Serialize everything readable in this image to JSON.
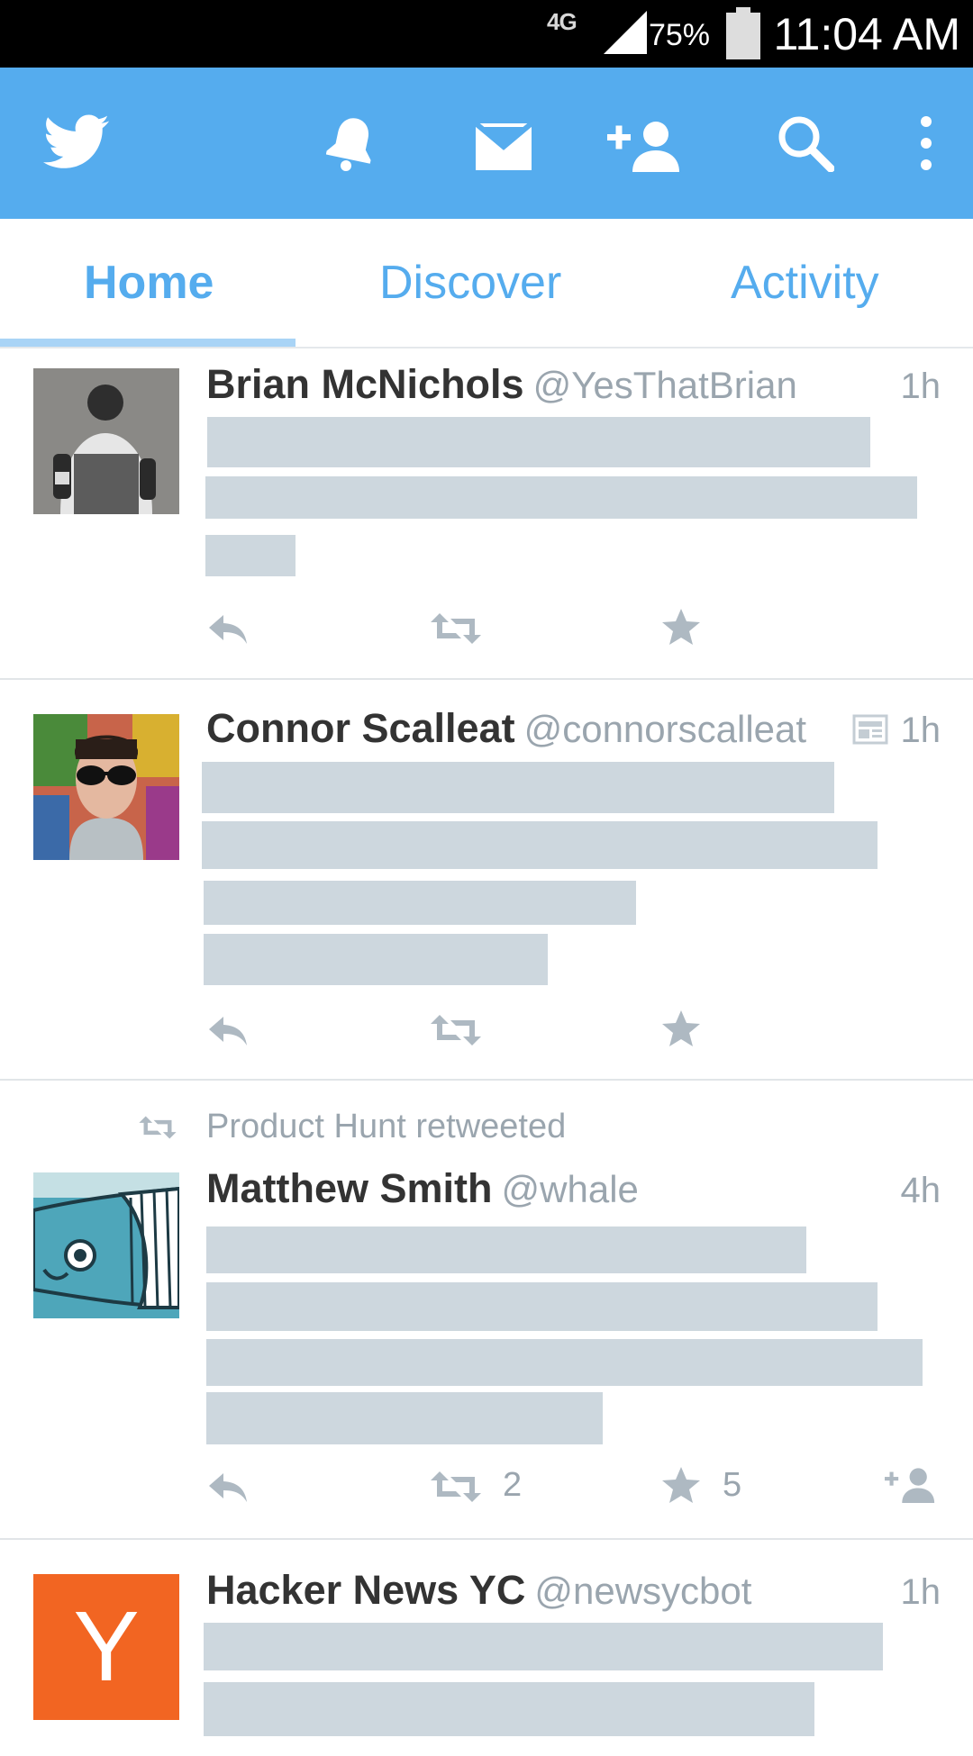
{
  "status_bar": {
    "network": "4G",
    "battery": "75%",
    "time": "11:04 AM"
  },
  "app_bar": {
    "icons": [
      "twitter-bird-icon",
      "notifications-bell-icon",
      "messages-envelope-icon",
      "add-user-icon",
      "search-icon",
      "overflow-menu-icon"
    ],
    "brand_color": "#55acee"
  },
  "tabs": [
    {
      "label": "Home",
      "active": true
    },
    {
      "label": "Discover",
      "active": false
    },
    {
      "label": "Activity",
      "active": false
    }
  ],
  "tweets": [
    {
      "name": "Brian McNichols",
      "handle": "@YesThatBrian",
      "time": "1h"
    },
    {
      "name": "Connor Scalleat",
      "handle": "@connorscalleat",
      "time": "1h",
      "has_media_icon": true
    },
    {
      "retweeted_by": "Product Hunt retweeted",
      "name": "Matthew Smith",
      "handle": "@whale",
      "time": "4h",
      "retweets": "2",
      "favorites": "5"
    },
    {
      "name": "Hacker News YC",
      "handle": "@newsycbot",
      "time": "1h",
      "avatar_letter": "Y"
    }
  ]
}
